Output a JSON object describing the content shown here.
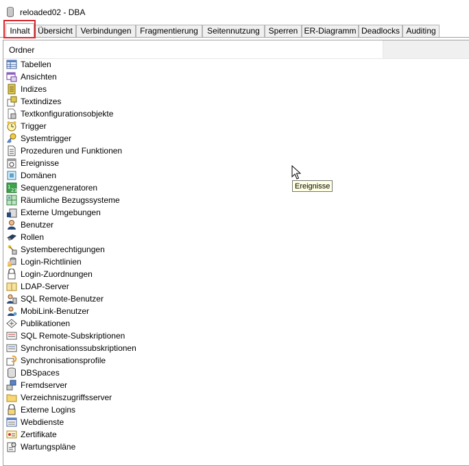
{
  "window": {
    "title": "reloaded02 - DBA"
  },
  "tabs": [
    {
      "label": "Inhalt",
      "active": true
    },
    {
      "label": "Übersicht"
    },
    {
      "label": "Verbindungen"
    },
    {
      "label": "Fragmentierung"
    },
    {
      "label": "Seitennutzung"
    },
    {
      "label": "Sperren"
    },
    {
      "label": "ER-Diagramm"
    },
    {
      "label": "Deadlocks"
    },
    {
      "label": "Auditing"
    }
  ],
  "list": {
    "header": "Ordner",
    "items": [
      {
        "label": "Tabellen",
        "icon": "table-icon"
      },
      {
        "label": "Ansichten",
        "icon": "view-icon"
      },
      {
        "label": "Indizes",
        "icon": "index-icon"
      },
      {
        "label": "Textindizes",
        "icon": "text-index-icon"
      },
      {
        "label": "Textkonfigurationsobjekte",
        "icon": "text-config-icon"
      },
      {
        "label": "Trigger",
        "icon": "trigger-icon"
      },
      {
        "label": "Systemtrigger",
        "icon": "system-trigger-icon"
      },
      {
        "label": "Prozeduren und Funktionen",
        "icon": "procedure-icon"
      },
      {
        "label": "Ereignisse",
        "icon": "event-icon"
      },
      {
        "label": "Domänen",
        "icon": "domain-icon"
      },
      {
        "label": "Sequenzgeneratoren",
        "icon": "sequence-icon"
      },
      {
        "label": "Räumliche Bezugssysteme",
        "icon": "spatial-icon"
      },
      {
        "label": "Externe Umgebungen",
        "icon": "external-env-icon"
      },
      {
        "label": "Benutzer",
        "icon": "user-icon"
      },
      {
        "label": "Rollen",
        "icon": "role-icon"
      },
      {
        "label": "Systemberechtigungen",
        "icon": "system-privilege-icon"
      },
      {
        "label": "Login-Richtlinien",
        "icon": "login-policy-icon"
      },
      {
        "label": "Login-Zuordnungen",
        "icon": "login-mapping-icon"
      },
      {
        "label": "LDAP-Server",
        "icon": "ldap-server-icon"
      },
      {
        "label": "SQL Remote-Benutzer",
        "icon": "remote-user-icon"
      },
      {
        "label": "MobiLink-Benutzer",
        "icon": "mobilink-user-icon"
      },
      {
        "label": "Publikationen",
        "icon": "publication-icon"
      },
      {
        "label": "SQL Remote-Subskriptionen",
        "icon": "remote-subscription-icon"
      },
      {
        "label": "Synchronisationssubskriptionen",
        "icon": "sync-subscription-icon"
      },
      {
        "label": "Synchronisationsprofile",
        "icon": "sync-profile-icon"
      },
      {
        "label": "DBSpaces",
        "icon": "dbspace-icon"
      },
      {
        "label": "Fremdserver",
        "icon": "remote-server-icon"
      },
      {
        "label": "Verzeichniszugriffsserver",
        "icon": "directory-server-icon"
      },
      {
        "label": "Externe Logins",
        "icon": "external-login-icon"
      },
      {
        "label": "Webdienste",
        "icon": "web-service-icon"
      },
      {
        "label": "Zertifikate",
        "icon": "certificate-icon"
      },
      {
        "label": "Wartungspläne",
        "icon": "maintenance-plan-icon"
      }
    ]
  },
  "tooltip": {
    "text": "Ereignisse"
  },
  "colors": {
    "highlight": "#d9252a",
    "tooltip_bg": "#ffffe1"
  }
}
